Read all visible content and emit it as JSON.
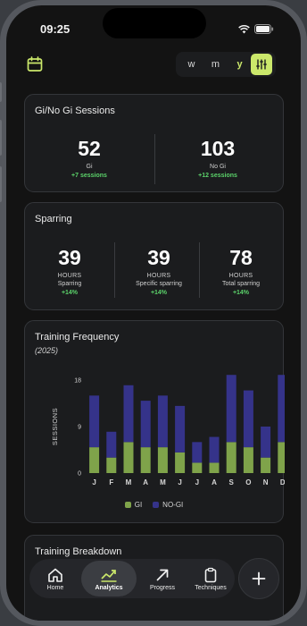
{
  "status_bar": {
    "time": "09:25"
  },
  "top_bar": {
    "periods": [
      "w",
      "m",
      "y"
    ],
    "active_period": "y",
    "accent_color": "#cbe86b"
  },
  "gi_card": {
    "title": "Gi/No Gi Sessions",
    "stats": [
      {
        "value": "52",
        "label": "Gi",
        "delta": "+7 sessions"
      },
      {
        "value": "103",
        "label": "No Gi",
        "delta": "+12 sessions"
      }
    ]
  },
  "sparring_card": {
    "title": "Sparring",
    "stats": [
      {
        "value": "39",
        "unit": "HOURS",
        "label": "Sparring",
        "delta": "+14%"
      },
      {
        "value": "39",
        "unit": "HOURS",
        "label": "Specific sparring",
        "delta": "+14%"
      },
      {
        "value": "78",
        "unit": "HOURS",
        "label": "Total sparring",
        "delta": "+14%"
      }
    ]
  },
  "frequency_card": {
    "title": "Training Frequency",
    "subtitle": "(2025)"
  },
  "chart_data": {
    "type": "bar",
    "stacked": true,
    "categories": [
      "J",
      "F",
      "M",
      "A",
      "M",
      "J",
      "J",
      "A",
      "S",
      "O",
      "N",
      "D"
    ],
    "series": [
      {
        "name": "GI",
        "color": "#7fa34a",
        "values": [
          5,
          3,
          6,
          5,
          5,
          4,
          2,
          2,
          6,
          5,
          3,
          6
        ]
      },
      {
        "name": "NO-GI",
        "color": "#35338a",
        "values": [
          10,
          5,
          11,
          9,
          10,
          9,
          4,
          5,
          13,
          11,
          6,
          13
        ]
      }
    ],
    "ylabel": "SESSIONS",
    "yticks": [
      0,
      9,
      18
    ],
    "ylim": [
      0,
      18
    ],
    "legend_position": "bottom"
  },
  "breakdown_card": {
    "title": "Training Breakdown"
  },
  "bottom_nav": {
    "items": [
      {
        "label": "Home",
        "icon": "home-icon"
      },
      {
        "label": "Analytics",
        "icon": "analytics-icon"
      },
      {
        "label": "Progress",
        "icon": "arrow-up-right-icon"
      },
      {
        "label": "Techniques",
        "icon": "clipboard-icon"
      }
    ],
    "active": "Analytics"
  }
}
